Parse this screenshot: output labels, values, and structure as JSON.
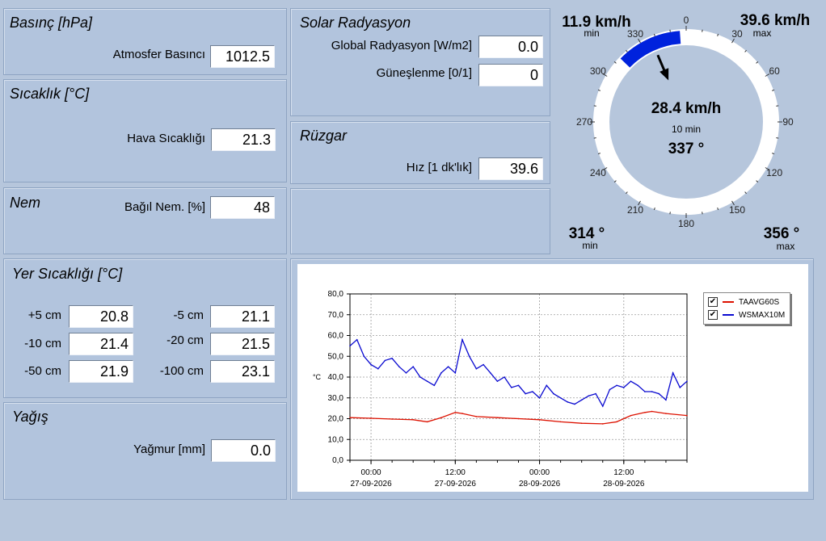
{
  "pressure": {
    "title": "Basınç [hPa]",
    "label": "Atmosfer Basıncı",
    "value": "1012.5"
  },
  "temperature": {
    "title": "Sıcaklık [°C]",
    "label": "Hava Sıcaklığı",
    "value": "21.3"
  },
  "humidity": {
    "title": "Nem",
    "label": "Bağıl Nem. [%]",
    "value": "48"
  },
  "solar": {
    "title": "Solar Radyasyon",
    "global_label": "Global Radyasyon [W/m2]",
    "global_value": "0.0",
    "sunshine_label": "Güneşlenme [0/1]",
    "sunshine_value": "0"
  },
  "wind": {
    "title": "Rüzgar",
    "speed_label": "Hız [1 dk'lık]",
    "speed_value": "39.6"
  },
  "soil": {
    "title": "Yer Sıcaklığı [°C]",
    "rows": [
      {
        "l1": "+5 cm",
        "v1": "20.8",
        "l2": "-5 cm",
        "v2": "21.1"
      },
      {
        "l1": "-10 cm",
        "v1": "21.4",
        "l2": "-20 cm",
        "v2": "21.5"
      },
      {
        "l1": "-50 cm",
        "v1": "21.9",
        "l2": "-100 cm",
        "v2": "23.1"
      }
    ]
  },
  "rain": {
    "title": "Yağış",
    "label": "Yağmur [mm]",
    "value": "0.0"
  },
  "compass": {
    "speed_min": "11.9 km/h",
    "speed_max": "39.6 km/h",
    "min_label": "min",
    "max_label": "max",
    "center_speed": "28.4 km/h",
    "avg_label": "10 min",
    "center_dir": "337 °",
    "dir_min": "314 °",
    "dir_max": "356 °",
    "dir_min_deg": 314,
    "dir_max_deg": 356,
    "dir_deg": 337,
    "ticks": [
      "0",
      "30",
      "60",
      "90",
      "120",
      "150",
      "180",
      "210",
      "240",
      "270",
      "300",
      "330"
    ],
    "arc_color": "#0022dd"
  },
  "chart_data": {
    "type": "line",
    "ylabel": "°C",
    "ylim": [
      0,
      80
    ],
    "y_ticks": [
      "80,0",
      "70,0",
      "60,0",
      "50,0",
      "40,0",
      "30,0",
      "20,0",
      "10,0",
      "0,0"
    ],
    "x_range": [
      "2026-09-26T21:00",
      "2026-09-28T21:00"
    ],
    "x_ticks": [
      {
        "time": "00:00",
        "date": "27-09-2026",
        "pos": "2026-09-27T00:00"
      },
      {
        "time": "12:00",
        "date": "27-09-2026",
        "pos": "2026-09-27T12:00"
      },
      {
        "time": "00:00",
        "date": "28-09-2026",
        "pos": "2026-09-28T00:00"
      },
      {
        "time": "12:00",
        "date": "28-09-2026",
        "pos": "2026-09-28T12:00"
      }
    ],
    "grid": true,
    "legend_position": "top-right",
    "series": [
      {
        "name": "TAAVG60S",
        "color": "#dd1100",
        "x": [
          "2026-09-26T21:00",
          "2026-09-27T00:00",
          "2026-09-27T03:00",
          "2026-09-27T06:00",
          "2026-09-27T08:00",
          "2026-09-27T10:00",
          "2026-09-27T12:00",
          "2026-09-27T13:00",
          "2026-09-27T15:00",
          "2026-09-27T18:00",
          "2026-09-27T21:00",
          "2026-09-28T00:00",
          "2026-09-28T03:00",
          "2026-09-28T06:00",
          "2026-09-28T09:00",
          "2026-09-28T11:00",
          "2026-09-28T13:00",
          "2026-09-28T15:00",
          "2026-09-28T16:00",
          "2026-09-28T18:00",
          "2026-09-28T21:00"
        ],
        "y": [
          20.5,
          20.2,
          19.8,
          19.5,
          18.5,
          20.5,
          23.0,
          22.5,
          21.0,
          20.5,
          20.0,
          19.5,
          18.5,
          17.8,
          17.5,
          18.5,
          21.5,
          23.0,
          23.5,
          22.5,
          21.5
        ]
      },
      {
        "name": "WSMAX10M",
        "color": "#0a0ad0",
        "x": [
          "2026-09-26T21:00",
          "2026-09-26T22:00",
          "2026-09-26T23:00",
          "2026-09-27T00:00",
          "2026-09-27T01:00",
          "2026-09-27T02:00",
          "2026-09-27T03:00",
          "2026-09-27T04:00",
          "2026-09-27T05:00",
          "2026-09-27T06:00",
          "2026-09-27T07:00",
          "2026-09-27T08:00",
          "2026-09-27T09:00",
          "2026-09-27T10:00",
          "2026-09-27T11:00",
          "2026-09-27T12:00",
          "2026-09-27T13:00",
          "2026-09-27T14:00",
          "2026-09-27T15:00",
          "2026-09-27T16:00",
          "2026-09-27T17:00",
          "2026-09-27T18:00",
          "2026-09-27T19:00",
          "2026-09-27T20:00",
          "2026-09-27T21:00",
          "2026-09-27T22:00",
          "2026-09-27T23:00",
          "2026-09-28T00:00",
          "2026-09-28T01:00",
          "2026-09-28T02:00",
          "2026-09-28T03:00",
          "2026-09-28T04:00",
          "2026-09-28T05:00",
          "2026-09-28T06:00",
          "2026-09-28T07:00",
          "2026-09-28T08:00",
          "2026-09-28T09:00",
          "2026-09-28T10:00",
          "2026-09-28T11:00",
          "2026-09-28T12:00",
          "2026-09-28T13:00",
          "2026-09-28T14:00",
          "2026-09-28T15:00",
          "2026-09-28T16:00",
          "2026-09-28T17:00",
          "2026-09-28T18:00",
          "2026-09-28T19:00",
          "2026-09-28T20:00",
          "2026-09-28T21:00"
        ],
        "y": [
          55,
          58,
          50,
          46,
          44,
          48,
          49,
          45,
          42,
          45,
          40,
          38,
          36,
          42,
          45,
          42,
          58,
          50,
          44,
          46,
          42,
          38,
          40,
          35,
          36,
          32,
          33,
          30,
          36,
          32,
          30,
          28,
          27,
          29,
          31,
          32,
          26,
          34,
          36,
          35,
          38,
          36,
          33,
          33,
          32,
          29,
          42,
          35,
          38
        ]
      }
    ]
  }
}
